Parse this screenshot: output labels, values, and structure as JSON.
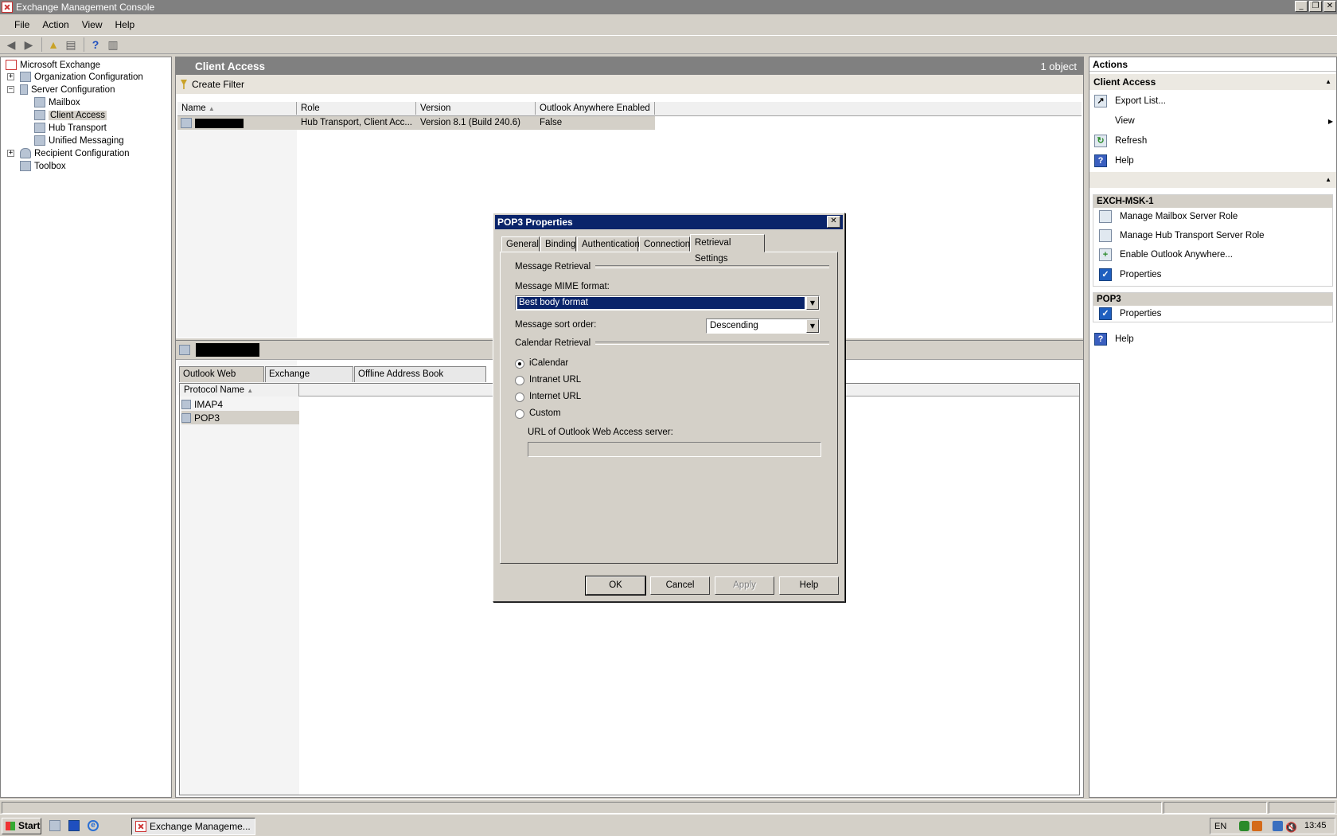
{
  "window": {
    "title": "Exchange Management Console"
  },
  "menu": [
    "File",
    "Action",
    "View",
    "Help"
  ],
  "tree": {
    "items": [
      {
        "label": "Microsoft Exchange"
      },
      {
        "label": "Organization Configuration"
      },
      {
        "label": "Server Configuration"
      },
      {
        "label": "Mailbox"
      },
      {
        "label": "Client Access"
      },
      {
        "label": "Hub Transport"
      },
      {
        "label": "Unified Messaging"
      },
      {
        "label": "Recipient Configuration"
      },
      {
        "label": "Toolbox"
      }
    ]
  },
  "center": {
    "title": "Client Access",
    "count": "1 object",
    "create_filter": "Create Filter",
    "columns": [
      "Name",
      "Role",
      "Version",
      "Outlook Anywhere Enabled"
    ],
    "row": {
      "role": "Hub Transport, Client Acc...",
      "version": "Version 8.1 (Build 240.6)",
      "outlook_anywhere": "False"
    },
    "tabs": [
      "Outlook Web Access",
      "Exchange ActiveSync",
      "Offline Address Book Distribution"
    ],
    "protocol_header": "Protocol Name",
    "protocols": [
      "IMAP4",
      "POP3"
    ]
  },
  "actions": {
    "header": "Actions",
    "section1": {
      "title": "Client Access",
      "items": [
        "Export List...",
        "View",
        "Refresh",
        "Help"
      ]
    },
    "section2": {
      "title": "EXCH-MSK-1",
      "items": [
        "Manage Mailbox Server Role",
        "Manage Hub Transport Server Role",
        "Enable Outlook Anywhere...",
        "Properties"
      ]
    },
    "section3": {
      "title": "POP3",
      "items": [
        "Properties"
      ]
    },
    "help": "Help"
  },
  "dialog": {
    "title": "POP3 Properties",
    "tabs": [
      "General",
      "Binding",
      "Authentication",
      "Connection",
      "Retrieval Settings"
    ],
    "message_retrieval": "Message Retrieval",
    "mime_label": "Message MIME format:",
    "mime_value": "Best body format",
    "sort_label": "Message sort order:",
    "sort_value": "Descending",
    "calendar_retrieval": "Calendar Retrieval",
    "radios": [
      "iCalendar",
      "Intranet URL",
      "Internet URL",
      "Custom"
    ],
    "selected_radio": "iCalendar",
    "url_label": "URL of Outlook Web Access server:",
    "url_value": "",
    "buttons": {
      "ok": "OK",
      "cancel": "Cancel",
      "apply": "Apply",
      "help": "Help"
    }
  },
  "taskbar": {
    "start": "Start",
    "task": "Exchange Manageme...",
    "lang": "EN",
    "time": "13:45"
  }
}
